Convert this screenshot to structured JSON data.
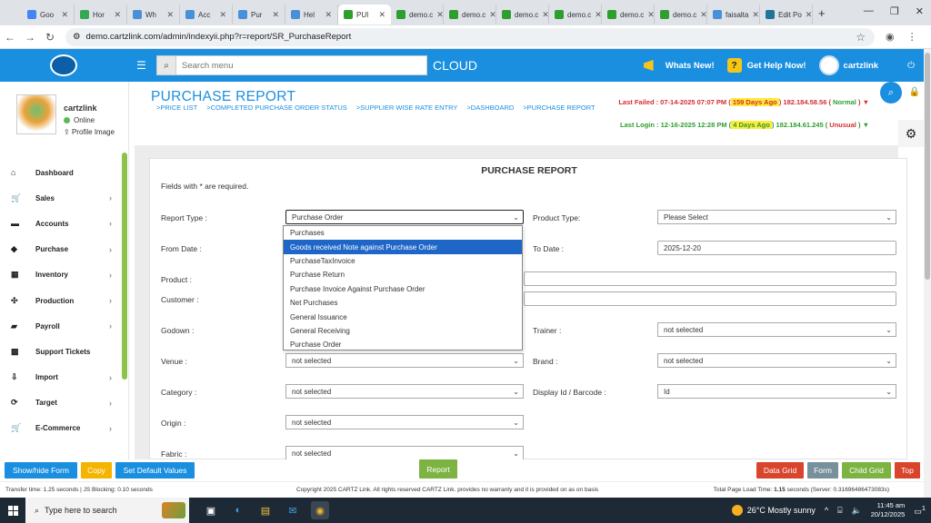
{
  "browser": {
    "tabs": [
      {
        "label": "Goo",
        "color": "#4285f4"
      },
      {
        "label": "Hor",
        "color": "#34a853"
      },
      {
        "label": "Wh",
        "color": "#4a90d9"
      },
      {
        "label": "Acc",
        "color": "#4a90d9"
      },
      {
        "label": "Pur",
        "color": "#4a90d9"
      },
      {
        "label": "Hel",
        "color": "#4a90d9"
      },
      {
        "label": "PUI",
        "color": "#2e9e2e"
      },
      {
        "label": "demo.c",
        "color": "#2e9e2e"
      },
      {
        "label": "demo.c",
        "color": "#2e9e2e"
      },
      {
        "label": "demo.c",
        "color": "#2e9e2e"
      },
      {
        "label": "demo.c",
        "color": "#2e9e2e"
      },
      {
        "label": "demo.c",
        "color": "#2e9e2e"
      },
      {
        "label": "demo.c",
        "color": "#2e9e2e"
      },
      {
        "label": "faisalta",
        "color": "#4a90d9"
      },
      {
        "label": "Edit Po",
        "color": "#21759b"
      }
    ],
    "active_tab_index": 6,
    "url": "demo.cartzlink.com/admin/indexyii.php?r=report/SR_PurchaseReport"
  },
  "header": {
    "search_placeholder": "Search menu",
    "cloud_label": "CLOUD",
    "whats_new": "Whats New!",
    "get_help": "Get Help Now!",
    "user": "cartzlink",
    "brand_color": "#1a8fe0"
  },
  "sidebar": {
    "user_name": "cartzlink",
    "status": "Online",
    "profile_image_label": "Profile Image",
    "items": [
      {
        "label": "Dashboard",
        "icon": "home-icon",
        "glyph": "⌂",
        "has_children": false
      },
      {
        "label": "Sales",
        "icon": "cart-icon",
        "glyph": "🛒",
        "has_children": true
      },
      {
        "label": "Accounts",
        "icon": "bank-icon",
        "glyph": "▬",
        "has_children": true
      },
      {
        "label": "Purchase",
        "icon": "tag-icon",
        "glyph": "◆",
        "has_children": true
      },
      {
        "label": "Inventory",
        "icon": "grid-icon",
        "glyph": "▦",
        "has_children": true
      },
      {
        "label": "Production",
        "icon": "cog-icon",
        "glyph": "✣",
        "has_children": true
      },
      {
        "label": "Payroll",
        "icon": "money-icon",
        "glyph": "▰",
        "has_children": true
      },
      {
        "label": "Support Tickets",
        "icon": "tickets-icon",
        "glyph": "▩",
        "has_children": false
      },
      {
        "label": "Import",
        "icon": "import-icon",
        "glyph": "⇩",
        "has_children": true
      },
      {
        "label": "Target",
        "icon": "target-icon",
        "glyph": "⟳",
        "has_children": true
      },
      {
        "label": "E-Commerce",
        "icon": "ecommerce-icon",
        "glyph": "🛒",
        "has_children": true
      }
    ]
  },
  "page": {
    "title": "PURCHASE REPORT",
    "breadcrumbs": [
      ">PRICE LIST",
      ">COMPLETED PURCHASE ORDER STATUS",
      ">SUPPLIER WISE RATE ENTRY",
      ">DASHBOARD",
      ">PURCHASE REPORT"
    ],
    "last_failed": {
      "prefix": "Last Failed : 07-14-2025 07:07 PM (",
      "ago": " 159 Days Ago ",
      "ip": ") 182.184.58.56 (",
      "status": " Normal ",
      "suffix": ") ▼"
    },
    "last_login": {
      "prefix": "Last Login : 12-16-2025 12:28 PM (",
      "ago": " 4 Days Ago ",
      "ip": ") 182.184.61.245 (",
      "status": " Unusual ",
      "suffix": ") ▼"
    }
  },
  "form": {
    "title": "PURCHASE REPORT",
    "required_note": "Fields with * are required.",
    "report_type_label": "Report Type :",
    "report_type_value": "Purchase Order",
    "report_type_options": [
      "Purchases",
      "Goods received Note against Purchase Order",
      "PurchaseTaxInvoice",
      "Purchase Return",
      "Purchase Invoice Against Purchase Order",
      "Net Purchases",
      "General Issuance",
      "General Receiving",
      "Purchase Order"
    ],
    "highlighted_option_index": 1,
    "product_type_label": "Product Type:",
    "product_type_value": "Please Select",
    "from_date_label": "From Date :",
    "to_date_label": "To Date :",
    "to_date_value": "2025-12-20",
    "product_label": "Product :",
    "customer_label": "Customer :",
    "godown_label": "Godown :",
    "trainer_label": "Trainer :",
    "trainer_value": "not selected",
    "venue_label": "Venue :",
    "venue_value": "not selected",
    "brand_label": "Brand :",
    "brand_value": "not selected",
    "category_label": "Category :",
    "category_value": "not selected",
    "display_id_label": "Display Id / Barcode :",
    "display_id_value": "Id",
    "origin_label": "Origin :",
    "origin_value": "not selected",
    "fabric_label": "Fabric :",
    "fabric_value": "not selected"
  },
  "buttons": {
    "show_hide_form": "Show/hide Form",
    "copy": "Copy",
    "set_default": "Set Default Values",
    "report": "Report",
    "data_grid": "Data Grid",
    "form": "Form",
    "child_grid": "Child Grid",
    "top": "Top"
  },
  "footer": {
    "transfer": "Transfer time: 1.25 seconds  | JS Blocking: 0.10 seconds",
    "copyright": "Copyright 2025 CARTZ Link. All rights reserved CARTZ Link. provides no warranty and it is provided on as on basis",
    "load_prefix": "Total Page Load Time: ",
    "load_bold": "1.15",
    "load_suffix": " seconds (Server: 0.31696486473083s)"
  },
  "taskbar": {
    "search_placeholder": "Type here to search",
    "weather": "26°C  Mostly sunny",
    "time": "11:45 am",
    "date": "20/12/2025",
    "badge": "1"
  }
}
